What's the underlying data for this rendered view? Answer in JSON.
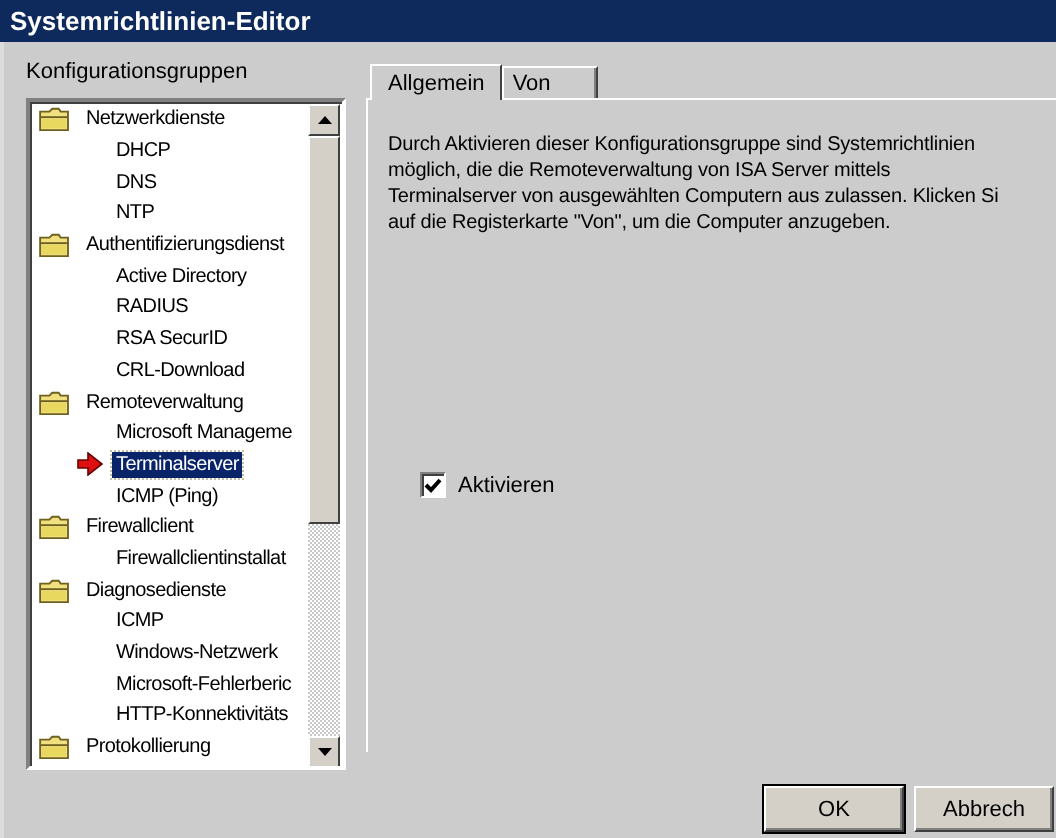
{
  "window": {
    "title": "Systemrichtlinien-Editor"
  },
  "groups_label": "Konfigurationsgruppen",
  "tree": [
    {
      "label": "Netzwerkdienste",
      "selected": false,
      "children": [
        {
          "label": "DHCP",
          "selected": false
        },
        {
          "label": "DNS",
          "selected": false
        },
        {
          "label": "NTP",
          "selected": false
        }
      ]
    },
    {
      "label": "Authentifizierungsdienst",
      "selected": false,
      "children": [
        {
          "label": "Active Directory",
          "selected": false
        },
        {
          "label": "RADIUS",
          "selected": false
        },
        {
          "label": "RSA SecurID",
          "selected": false
        },
        {
          "label": "CRL-Download",
          "selected": false
        }
      ]
    },
    {
      "label": "Remoteverwaltung",
      "selected": false,
      "children": [
        {
          "label": "Microsoft Manageme",
          "selected": false
        },
        {
          "label": "Terminalserver",
          "selected": true
        },
        {
          "label": "ICMP (Ping)",
          "selected": false
        }
      ]
    },
    {
      "label": "Firewallclient",
      "selected": false,
      "children": [
        {
          "label": "Firewallclientinstallat",
          "selected": false
        }
      ]
    },
    {
      "label": "Diagnosedienste",
      "selected": false,
      "children": [
        {
          "label": "ICMP",
          "selected": false
        },
        {
          "label": "Windows-Netzwerk",
          "selected": false
        },
        {
          "label": "Microsoft-Fehlerberic",
          "selected": false
        },
        {
          "label": "HTTP-Konnektivitäts",
          "selected": false
        }
      ]
    },
    {
      "label": "Protokollierung",
      "selected": false
    }
  ],
  "tabs": [
    {
      "label": "Allgemein",
      "selected": true
    },
    {
      "label": "Von",
      "selected": false
    }
  ],
  "description_lines": [
    "Durch Aktivieren dieser Konfigurationsgruppe sind Systemrichtlinien",
    "möglich, die die Remoteverwaltung von ISA Server mittels",
    "Terminalserver von ausgewählten Computern aus zulassen. Klicken Si",
    "auf die Registerkarte \"Von\", um die Computer anzugeben."
  ],
  "enable": {
    "label": "Aktivieren",
    "checked": true
  },
  "buttons": [
    "OK",
    "Abbrech"
  ]
}
